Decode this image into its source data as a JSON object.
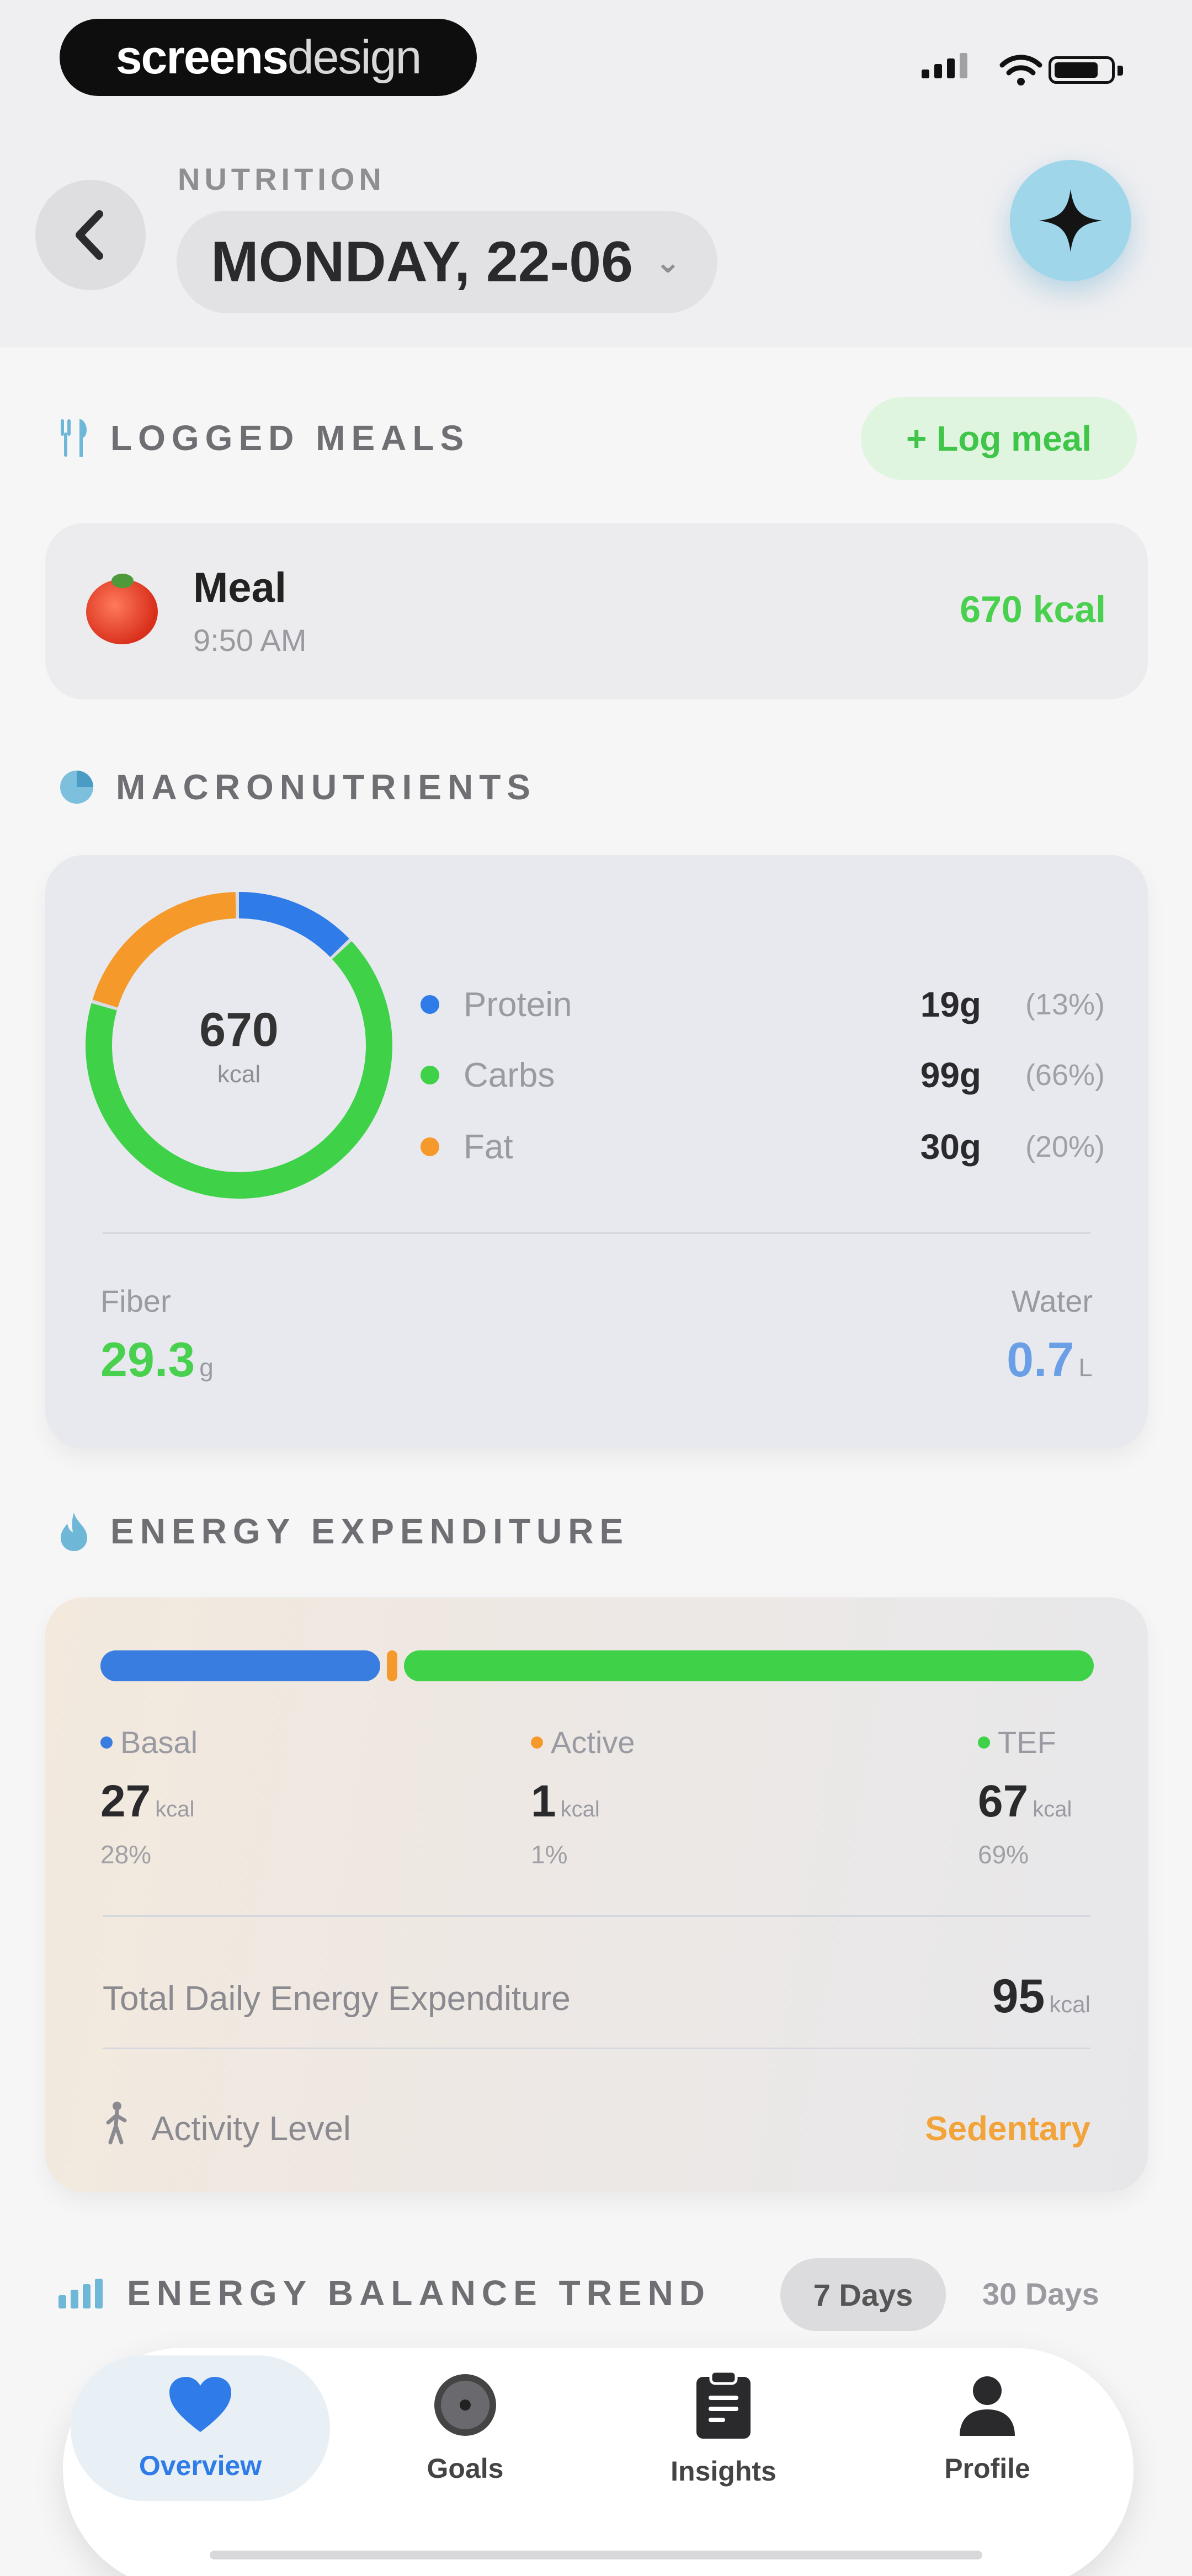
{
  "brand": {
    "bold": "screens",
    "light": "design"
  },
  "header": {
    "kicker": "NUTRITION",
    "date": "MONDAY, 22-06"
  },
  "logged_meals": {
    "title": "LOGGED MEALS",
    "log_button": "+ Log meal",
    "meals": [
      {
        "name": "Meal",
        "time": "9:50 AM",
        "kcal": "670 kcal"
      }
    ]
  },
  "macros": {
    "title": "MACRONUTRIENTS",
    "total": "670",
    "unit": "kcal",
    "items": [
      {
        "name": "Protein",
        "grams": "19g",
        "pct": "(13%)",
        "color": "#2f7be8",
        "share": 0.13
      },
      {
        "name": "Carbs",
        "grams": "99g",
        "pct": "(66%)",
        "color": "#3fd248",
        "share": 0.66
      },
      {
        "name": "Fat",
        "grams": "30g",
        "pct": "(20%)",
        "color": "#f59a2a",
        "share": 0.2
      }
    ],
    "fiber": {
      "label": "Fiber",
      "value": "29.3",
      "unit": "g"
    },
    "water": {
      "label": "Water",
      "value": "0.7",
      "unit": "L"
    }
  },
  "energy": {
    "title": "ENERGY EXPENDITURE",
    "parts": [
      {
        "name": "Basal",
        "value": "27",
        "unit": "kcal",
        "pct": "28%",
        "share": 0.28,
        "color": "#3a7de0"
      },
      {
        "name": "Active",
        "value": "1",
        "unit": "kcal",
        "pct": "1%",
        "share": 0.01,
        "color": "#f59a2a"
      },
      {
        "name": "TEF",
        "value": "67",
        "unit": "kcal",
        "pct": "69%",
        "share": 0.69,
        "color": "#3fd248"
      }
    ],
    "tdee_label": "Total Daily Energy Expenditure",
    "tdee_value": "95",
    "tdee_unit": "kcal",
    "activity_label": "Activity Level",
    "activity_value": "Sedentary"
  },
  "trend": {
    "title": "ENERGY BALANCE TREND",
    "range_selected": "7 Days",
    "range_other": "30 Days"
  },
  "tabs": [
    {
      "label": "Overview",
      "icon": "heart-icon"
    },
    {
      "label": "Goals",
      "icon": "target-icon"
    },
    {
      "label": "Insights",
      "icon": "clipboard-icon"
    },
    {
      "label": "Profile",
      "icon": "person-icon"
    }
  ]
}
